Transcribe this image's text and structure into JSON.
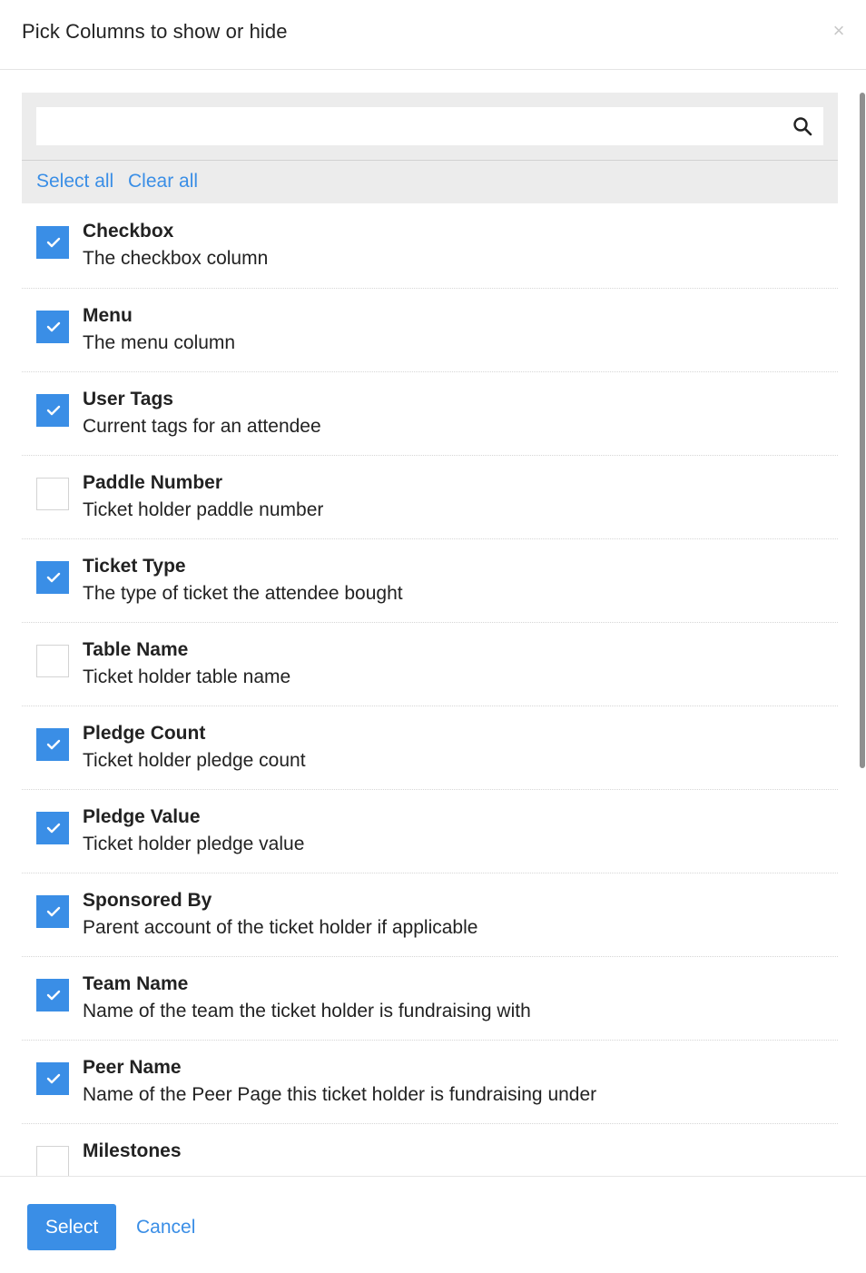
{
  "modal": {
    "title": "Pick Columns to show or hide",
    "close_label": "×"
  },
  "search": {
    "value": "",
    "placeholder": "",
    "icon": "search-icon"
  },
  "actions": {
    "select_all": "Select all",
    "clear_all": "Clear all"
  },
  "columns": [
    {
      "name": "Checkbox",
      "description": "The checkbox column",
      "checked": true
    },
    {
      "name": "Menu",
      "description": "The menu column",
      "checked": true
    },
    {
      "name": "User Tags",
      "description": "Current tags for an attendee",
      "checked": true
    },
    {
      "name": "Paddle Number",
      "description": "Ticket holder paddle number",
      "checked": false
    },
    {
      "name": "Ticket Type",
      "description": "The type of ticket the attendee bought",
      "checked": true
    },
    {
      "name": "Table Name",
      "description": "Ticket holder table name",
      "checked": false
    },
    {
      "name": "Pledge Count",
      "description": "Ticket holder pledge count",
      "checked": true
    },
    {
      "name": "Pledge Value",
      "description": "Ticket holder pledge value",
      "checked": true
    },
    {
      "name": "Sponsored By",
      "description": "Parent account of the ticket holder if applicable",
      "checked": true
    },
    {
      "name": "Team Name",
      "description": "Name of the team the ticket holder is fundraising with",
      "checked": true
    },
    {
      "name": "Peer Name",
      "description": "Name of the Peer Page this ticket holder is fundraising under",
      "checked": true
    },
    {
      "name": "Milestones",
      "description": "",
      "checked": false
    }
  ],
  "footer": {
    "select_label": "Select",
    "cancel_label": "Cancel"
  },
  "colors": {
    "accent": "#3a8ee6",
    "panel_bg": "#ececec"
  }
}
